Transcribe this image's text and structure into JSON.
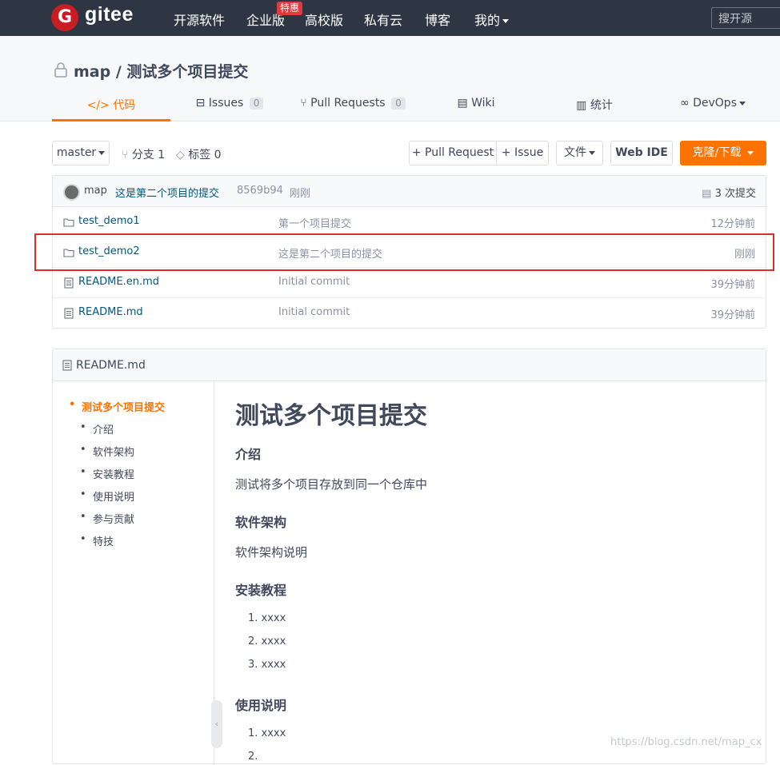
{
  "nav": {
    "logo_letter": "G",
    "brand": "gitee",
    "links": [
      "开源软件",
      "企业版",
      "高校版",
      "私有云",
      "博客",
      "我的"
    ],
    "badge": "特惠",
    "search_placeholder": "搜开源",
    "bg_color": "#2e3643"
  },
  "repo": {
    "title": "map / 测试多个项目提交",
    "tabs": [
      {
        "label": "代码",
        "icon": "code-icon",
        "active": true
      },
      {
        "label": "Issues",
        "count": "0",
        "icon": "issues-icon"
      },
      {
        "label": "Pull Requests",
        "count": "0",
        "icon": "pull-request-icon"
      },
      {
        "label": "Wiki",
        "icon": "wiki-icon"
      },
      {
        "label": "统计",
        "icon": "stats-icon"
      },
      {
        "label": "DevOps",
        "icon": "devops-icon"
      }
    ],
    "accent_color": "#fe7300"
  },
  "toolbar": {
    "branch": "master",
    "branches": "分支 1",
    "tags": "标签 0",
    "pull_request": "+ Pull Request",
    "issue": "+ Issue",
    "file": "文件",
    "web_ide": "Web IDE",
    "clone": "克隆/下载"
  },
  "commit": {
    "author": "map",
    "message": "这是第二个项目的提交",
    "hash": "8569b94",
    "time": "刚刚",
    "count": "3 次提交"
  },
  "files": [
    {
      "name": "test_demo1",
      "type": "folder",
      "message": "第一个项目提交",
      "time": "12分钟前"
    },
    {
      "name": "test_demo2",
      "type": "folder",
      "message": "这是第二个项目的提交",
      "time": "刚刚"
    },
    {
      "name": "README.en.md",
      "type": "file",
      "message": "Initial commit",
      "time": "39分钟前"
    },
    {
      "name": "README.md",
      "type": "file",
      "message": "Initial commit",
      "time": "39分钟前"
    }
  ],
  "readme": {
    "filename": "README.md",
    "toc": [
      "测试多个项目提交",
      "介绍",
      "软件架构",
      "安装教程",
      "使用说明",
      "参与贡献",
      "特技"
    ],
    "title": "测试多个项目提交",
    "sections": [
      {
        "heading": "介绍",
        "text": "测试将多个项目存放到同一个仓库中"
      },
      {
        "heading": "软件架构",
        "text": "软件架构说明"
      },
      {
        "heading": "安装教程",
        "items": [
          "1. xxxx",
          "2. xxxx",
          "3. xxxx"
        ]
      },
      {
        "heading": "使用说明",
        "items": [
          "1. xxxx",
          "2."
        ]
      }
    ]
  },
  "watermark": "https://blog.csdn.net/map_cx"
}
